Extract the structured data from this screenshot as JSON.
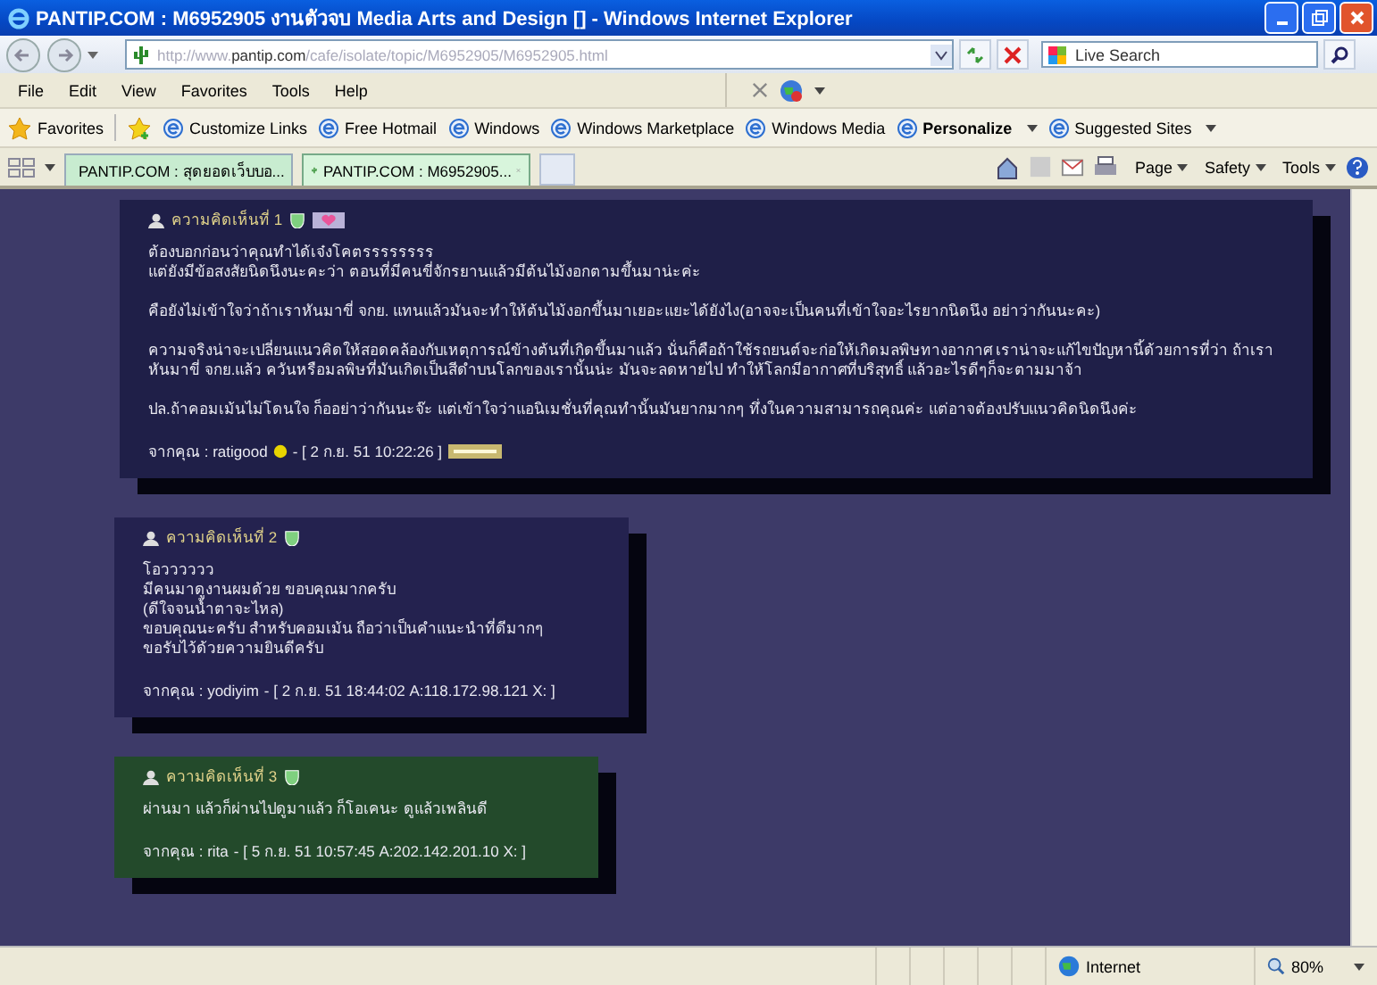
{
  "window": {
    "title": "PANTIP.COM : M6952905 งานตัวจบ Media Arts and Design [] - Windows Internet Explorer"
  },
  "address": {
    "prefix": "http://www.",
    "host": "pantip.com",
    "path": "/cafe/isolate/topic/M6952905/M6952905.html"
  },
  "search": {
    "placeholder": "Live Search"
  },
  "menu": [
    "File",
    "Edit",
    "View",
    "Favorites",
    "Tools",
    "Help"
  ],
  "favorites_bar": {
    "label": "Favorites",
    "links": [
      {
        "label": "Customize Links",
        "emphasized": false,
        "has_menu": false
      },
      {
        "label": "Free Hotmail",
        "emphasized": false,
        "has_menu": false
      },
      {
        "label": "Windows",
        "emphasized": false,
        "has_menu": false
      },
      {
        "label": "Windows Marketplace",
        "emphasized": false,
        "has_menu": false
      },
      {
        "label": "Windows Media",
        "emphasized": false,
        "has_menu": false
      },
      {
        "label": "Personalize",
        "emphasized": true,
        "has_menu": true
      },
      {
        "label": "Suggested Sites",
        "emphasized": false,
        "has_menu": true
      }
    ]
  },
  "tabs": [
    {
      "label": "PANTIP.COM : สุดยอดเว็บบอ...",
      "selected": false
    },
    {
      "label": "PANTIP.COM : M6952905...",
      "selected": true
    }
  ],
  "command_bar": [
    "Page",
    "Safety",
    "Tools"
  ],
  "comments": [
    {
      "header": "ความคิดเห็นที่ 1",
      "heart_badge": true,
      "color": "#1f1f48",
      "paragraphs": [
        [
          "ต้องบอกก่อนว่าคุณทำได้เจ๋งโคตรรรรรรรร",
          "แต่ยังมีข้อสงสัยนิดนึงนะคะว่า ตอนที่มีคนขี่จักรยานแล้วมีต้นไม้งอกตามขึ้นมาน่ะค่ะ"
        ],
        [
          "คือยังไม่เข้าใจว่าถ้าเราหันมาขี่ จกย. แทนแล้วมันจะทำให้ต้นไม้งอกขึ้นมาเยอะแยะได้ยังไง(อาจจะเป็นคนที่เข้าใจอะไรยากนิดนึง อย่าว่ากันนะคะ)"
        ],
        [
          "ความจริงน่าจะเปลี่ยนแนวคิดให้สอดคล้องกับเหตุการณ์ข้างต้นที่เกิดขึ้นมาแล้ว นั่นก็คือถ้าใช้รถยนต์จะก่อให้เกิดมลพิษทางอากาศ เราน่าจะแก้ไขปัญหานี้ด้วยการที่ว่า ถ้าเราหันมาขี่ จกย.แล้ว ควันหรือมลพิษที่มันเกิดเป็นสีดำบนโลกของเรานั้นน่ะ มันจะลดหายไป ทำให้โลกมีอากาศที่บริสุทธิ์ แล้วอะไรดีๆก็จะตามมาจ้า"
        ],
        [
          "ปล.ถ้าคอมเม้นไม่โดนใจ ก็ออย่าว่ากันนะจ๊ะ แต่เข้าใจว่าแอนิเมชั่นที่คุณทำนั้นมันยากมากๆ ทึ่งในความสามารถคุณค่ะ แต่อาจต้องปรับแนวคิดนิดนึงค่ะ"
        ]
      ],
      "from": "จากคุณ : ratigood",
      "smiley": true,
      "stamp": "- [ 2 ก.ย. 51 10:22:26 ]",
      "edit_badge": true
    },
    {
      "header": "ความคิดเห็นที่ 2",
      "heart_badge": false,
      "color": "#24224f",
      "paragraphs": [
        [
          "โอวววววว",
          "มีคนมาดูงานผมด้วย ขอบคุณมากครับ",
          "(ดีใจจนน้ำตาจะไหล)",
          "ขอบคุณนะครับ สำหรับคอมเม้น ถือว่าเป็นคำแนะนำที่ดีมากๆ",
          "ขอรับไว้ด้วยความยินดีครับ"
        ]
      ],
      "from": "จากคุณ : yodiyim",
      "smiley": false,
      "stamp": "- [ 2 ก.ย. 51 18:44:02 A:118.172.98.121 X: ]",
      "edit_badge": false
    },
    {
      "header": "ความคิดเห็นที่ 3",
      "heart_badge": false,
      "color": "#234a2b",
      "paragraphs": [
        [
          "ผ่านมา แล้วก็ผ่านไปดูมาแล้ว ก็โอเคนะ ดูแล้วเพลินดี"
        ]
      ],
      "from": "จากคุณ : rita",
      "smiley": false,
      "stamp": "- [ 5 ก.ย. 51 10:57:45 A:202.142.201.10 X: ]",
      "edit_badge": false
    }
  ],
  "status_bar": {
    "zone": "Internet",
    "zoom": "80%"
  }
}
